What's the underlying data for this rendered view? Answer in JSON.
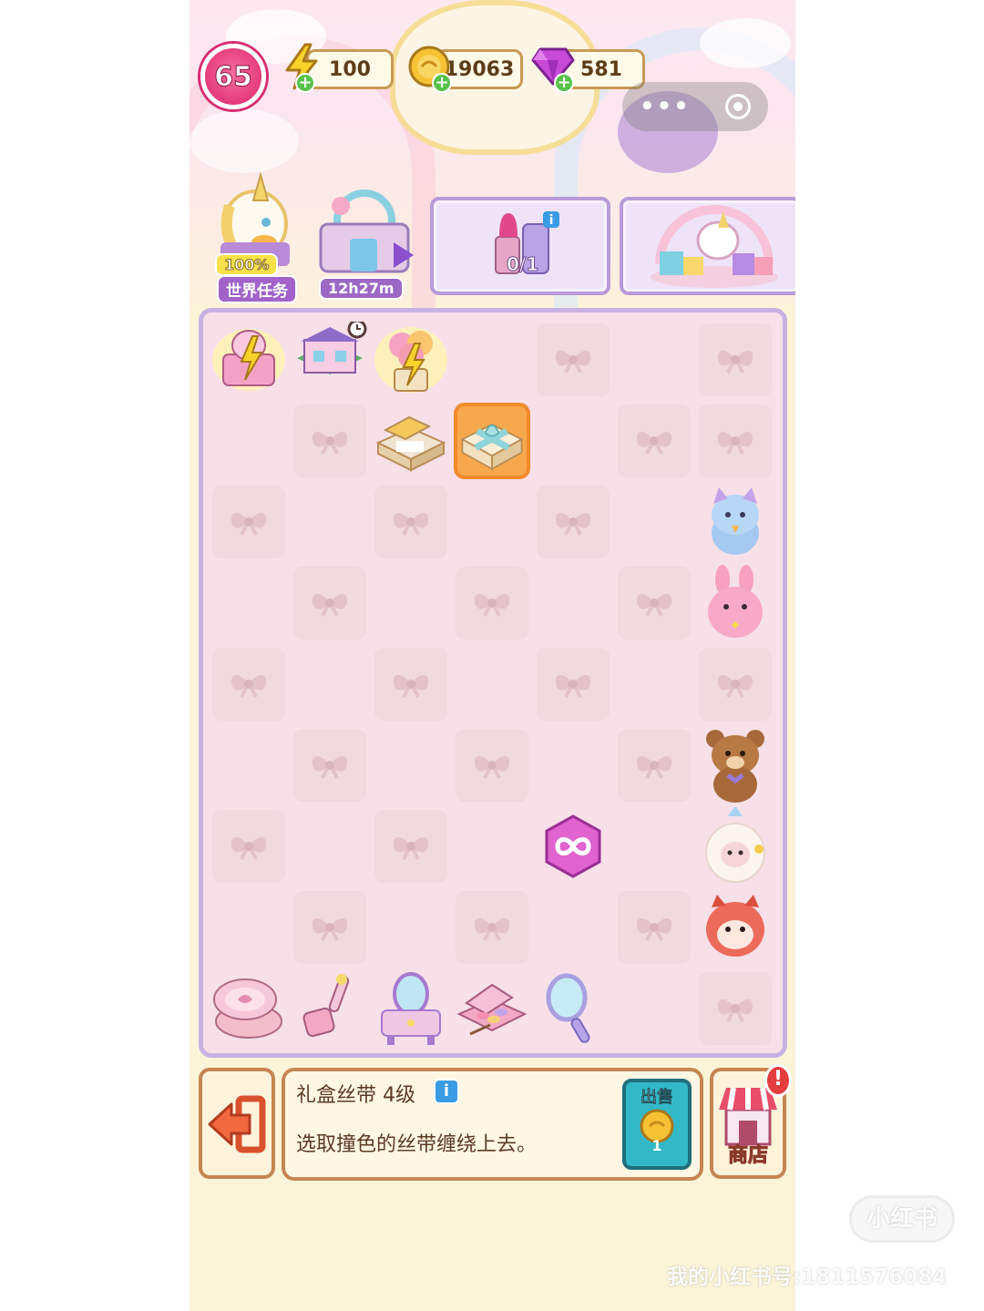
{
  "hud": {
    "level": "65",
    "energy": "100",
    "coins": "19063",
    "gems": "581"
  },
  "features": {
    "world_task_percent": "100%",
    "world_task_label": "世界任务",
    "event_timer": "12h27m",
    "order_progress": "0/1"
  },
  "board": {
    "cols": 7,
    "rows": 9,
    "empty_cells": [
      [
        0,
        3
      ],
      [
        0,
        5
      ],
      [
        1,
        0
      ],
      [
        1,
        2
      ],
      [
        1,
        4
      ],
      [
        2,
        1
      ],
      [
        2,
        3
      ],
      [
        2,
        5
      ],
      [
        3,
        0
      ],
      [
        3,
        2
      ],
      [
        3,
        4
      ],
      [
        4,
        1
      ],
      [
        4,
        3
      ],
      [
        4,
        5
      ],
      [
        5,
        0
      ],
      [
        5,
        2
      ],
      [
        5,
        4
      ],
      [
        6,
        1
      ],
      [
        6,
        3
      ],
      [
        6,
        5
      ],
      [
        7,
        0
      ],
      [
        7,
        2
      ],
      [
        7,
        4
      ],
      [
        8,
        5
      ]
    ],
    "items": [
      {
        "row": 0,
        "col": 0,
        "name": "vanity-generator-item"
      },
      {
        "row": 0,
        "col": 1,
        "name": "house-generator-item"
      },
      {
        "row": 0,
        "col": 2,
        "name": "balloon-generator-item"
      },
      {
        "row": 1,
        "col": 2,
        "name": "open-gift-box-item"
      },
      {
        "row": 1,
        "col": 3,
        "name": "gift-box-ribbon-item",
        "selected": true
      },
      {
        "row": 2,
        "col": 6,
        "name": "blue-cat-plush-item"
      },
      {
        "row": 3,
        "col": 6,
        "name": "pink-bunny-plush-item"
      },
      {
        "row": 5,
        "col": 6,
        "name": "teddy-bear-plush-item"
      },
      {
        "row": 6,
        "col": 4,
        "name": "infinity-energy-item"
      },
      {
        "row": 6,
        "col": 6,
        "name": "sheep-plush-item"
      },
      {
        "row": 7,
        "col": 6,
        "name": "red-panda-plush-item"
      },
      {
        "row": 8,
        "col": 0,
        "name": "powder-compact-item"
      },
      {
        "row": 8,
        "col": 1,
        "name": "lint-roller-item"
      },
      {
        "row": 8,
        "col": 2,
        "name": "vanity-table-item"
      },
      {
        "row": 8,
        "col": 3,
        "name": "eyeshadow-palette-item"
      },
      {
        "row": 8,
        "col": 4,
        "name": "hand-mirror-item"
      }
    ]
  },
  "info": {
    "title": "礼盒丝带 4级",
    "description": "选取撞色的丝带缠绕上去。",
    "sell_label": "出售",
    "sell_price": "1"
  },
  "shop": {
    "label": "商店",
    "alert": "!"
  },
  "watermark": {
    "logo": "小红书",
    "text": "我的小红书号:1811576084",
    "id": "1811576084"
  },
  "colors": {
    "board_bg": "#f7e0e8",
    "board_border": "#c9b2e2",
    "locked_cell": "#f0d9df",
    "bottom_border": "#c68653",
    "level_badge": "#e43a7b"
  }
}
